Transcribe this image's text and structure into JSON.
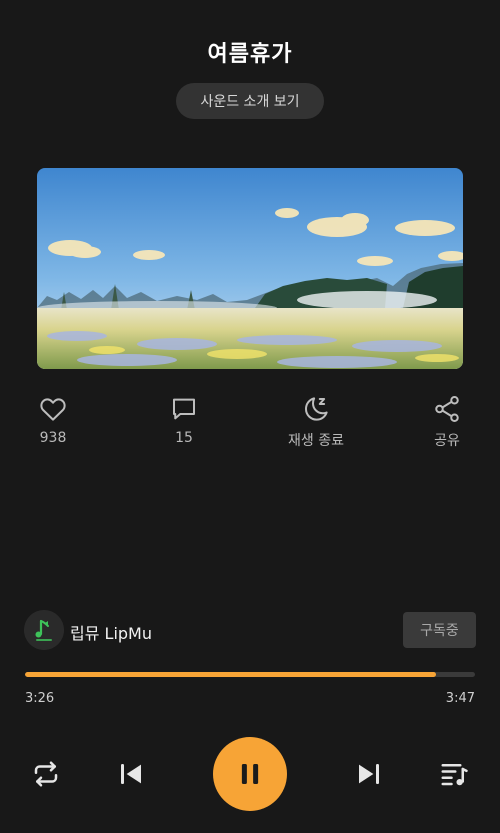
{
  "header": {
    "title": "여름휴가",
    "intro_button": "사운드 소개 보기"
  },
  "artwork": {
    "description_icon": "landscape-image"
  },
  "actions": [
    {
      "name": "like",
      "icon": "heart-icon",
      "label": "938"
    },
    {
      "name": "comment",
      "icon": "comment-icon",
      "label": "15"
    },
    {
      "name": "sleep-timer",
      "icon": "moon-icon",
      "label": "재생 종료"
    },
    {
      "name": "share",
      "icon": "share-icon",
      "label": "공유"
    }
  ],
  "artist": {
    "name": "립뮤 LipMu",
    "subscribe_label": "구독중"
  },
  "player": {
    "current_time": "3:26",
    "total_time": "3:47",
    "progress": 0.913,
    "accent": "#f7a436"
  },
  "controls": {
    "repeat": "repeat-icon",
    "previous": "skip-previous-icon",
    "play_pause": "pause-icon",
    "next": "skip-next-icon",
    "playlist": "playlist-icon"
  }
}
